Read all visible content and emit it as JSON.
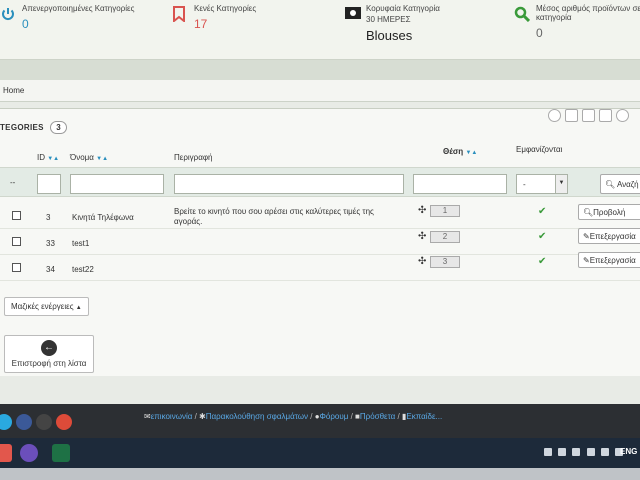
{
  "kpis": [
    {
      "label": "Απενεργοποιημένες Κατηγορίες",
      "value": "0",
      "icon": "power-icon"
    },
    {
      "label": "Κενές Κατηγορίες",
      "value": "17",
      "icon": "bookmark-icon"
    },
    {
      "label": "Κορυφαία Κατηγορία",
      "sublabel": "30 ΗΜΕΡΕΣ",
      "value": "Blouses",
      "icon": "money-icon"
    },
    {
      "label": "Μέσος αριθμός προϊόντων σε κατηγορία",
      "value": "0",
      "icon": "search-icon"
    }
  ],
  "breadcrumb": {
    "home": "Home"
  },
  "panel": {
    "title": "TEGORIES",
    "count": "3",
    "toolbar_icons": [
      "add-icon",
      "cloud-icon",
      "edit-icon",
      "export-icon",
      "refresh-icon"
    ]
  },
  "table": {
    "headers": {
      "id": "ID",
      "name": "Όνομα",
      "description": "Περιγραφή",
      "position": "Θέση",
      "displayed": "Εμφανίζονται"
    },
    "filters": {
      "dash": "--",
      "displayed_select": "-",
      "search_label": "Αναζή"
    },
    "rows": [
      {
        "id": "3",
        "name": "Κινητά Τηλέφωνα",
        "description": "Βρείτε το κινητό που σου αρέσει στις καλύτερες τιμές της αγοράς.",
        "position": "1",
        "action": "Προβολή"
      },
      {
        "id": "33",
        "name": "test1",
        "description": "",
        "position": "2",
        "action": "Επεξεργασία"
      },
      {
        "id": "34",
        "name": "test22",
        "description": "",
        "position": "3",
        "action": "Επεξεργασία"
      }
    ]
  },
  "bulk_actions": "Μαζικές ενέργειες",
  "back_to_list": "Επιστροφή στη λίστα",
  "footer": {
    "links": [
      {
        "text": "επικοινωνία",
        "icon": "envelope-icon"
      },
      {
        "text": "Παρακολούθηση σφαλμάτων",
        "icon": "bug-icon"
      },
      {
        "text": "Φόρουμ",
        "icon": "chat-icon"
      },
      {
        "text": "Πρόσθετα",
        "icon": "puzzle-icon"
      },
      {
        "text": "Εκπαίδε...",
        "icon": "book-icon"
      }
    ]
  },
  "taskbar": {
    "language": "ENG"
  },
  "colors": {
    "accent_blue": "#2a8fbd",
    "danger_red": "#d9534f",
    "success_green": "#3a9a3a"
  }
}
